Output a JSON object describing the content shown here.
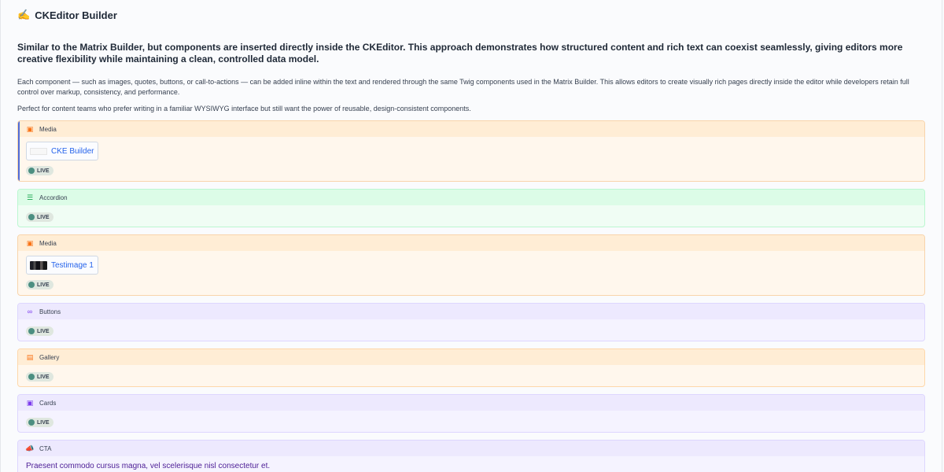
{
  "page": {
    "title": "CKEditor Builder",
    "title_icon": "✍️",
    "headline": "Similar to the Matrix Builder, but components are inserted directly inside the CKEditor. This approach demonstrates how structured content and rich text can coexist seamlessly, giving editors more creative flexibility while maintaining a clean, controlled data model.",
    "description_1": "Each component — such as images, quotes, buttons, or call-to-actions — can be added inline within the text and rendered through the same Twig components used in the Matrix Builder. This allows editors to create visually rich pages directly inside the editor while developers retain full control over markup, consistency, and performance.",
    "description_2": "Perfect for content teams who prefer writing in a familiar WYSIWYG interface but still want the power of reusable, design-consistent components."
  },
  "blocks": [
    {
      "type": "Media",
      "icon": "image-icon",
      "status": "LIVE",
      "asset_label": "CKE Builder"
    },
    {
      "type": "Accordion",
      "icon": "list-icon",
      "status": "LIVE"
    },
    {
      "type": "Media",
      "icon": "image-icon",
      "status": "LIVE",
      "asset_label": "Testimage 1"
    },
    {
      "type": "Buttons",
      "icon": "link-icon",
      "status": "LIVE"
    },
    {
      "type": "Gallery",
      "icon": "gallery-icon",
      "status": "LIVE"
    },
    {
      "type": "Cards",
      "icon": "cards-icon",
      "status": "LIVE"
    },
    {
      "type": "CTA",
      "icon": "megaphone-icon",
      "text": "Praesent commodo cursus magna, vel scelerisque nisl consectetur et."
    }
  ],
  "colors": {
    "media_header": "#ffedd5",
    "accordion_header": "#dcfce7",
    "purple_header": "#ede9fe",
    "live_dot": "#4c8f81",
    "link_blue": "#2563eb",
    "cta_text": "#4c1d95"
  }
}
